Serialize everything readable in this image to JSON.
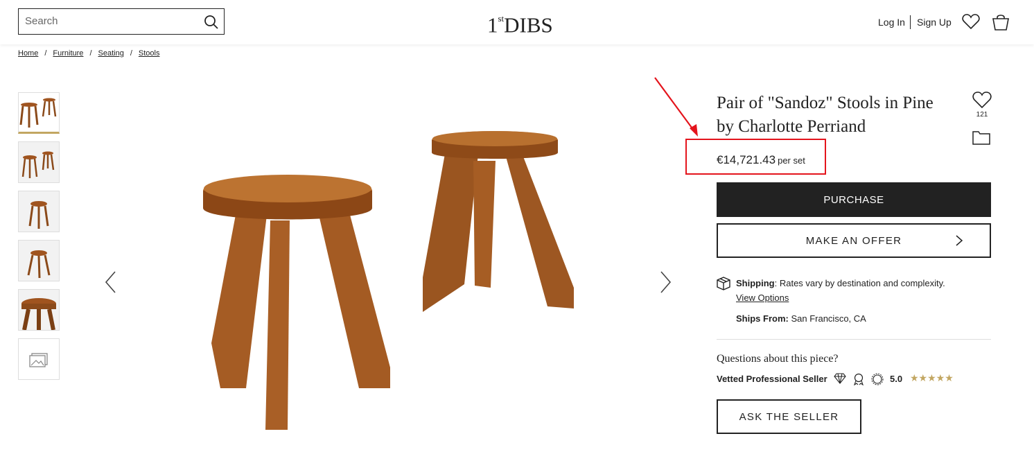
{
  "header": {
    "search_placeholder": "Search",
    "logo_main": "DIBS",
    "logo_prefix": "1",
    "logo_sup": "st",
    "login": "Log In",
    "signup": "Sign Up"
  },
  "breadcrumb": [
    "Home",
    "Furniture",
    "Seating",
    "Stools"
  ],
  "product": {
    "title": "Pair of \"Sandoz\" Stools in Pine by Charlotte Perriand",
    "favorites_count": "121",
    "price": "€14,721.43",
    "price_unit": "per set",
    "purchase_label": "PURCHASE",
    "offer_label": "MAKE AN OFFER",
    "shipping_label": "Shipping",
    "shipping_text": ": Rates vary by destination and complexity.",
    "view_options": "View Options",
    "ships_from_label": "Ships From:",
    "ships_from_value": " San Francisco, CA",
    "questions": "Questions about this piece?",
    "vetted": "Vetted Professional Seller",
    "rating": "5.0",
    "stars": "★★★★★",
    "ask_label": "ASK THE SELLER"
  },
  "colors": {
    "accent_gold": "#c2a661",
    "highlight_red": "#e4141c",
    "dark": "#222222",
    "wood": "#a0541f"
  }
}
